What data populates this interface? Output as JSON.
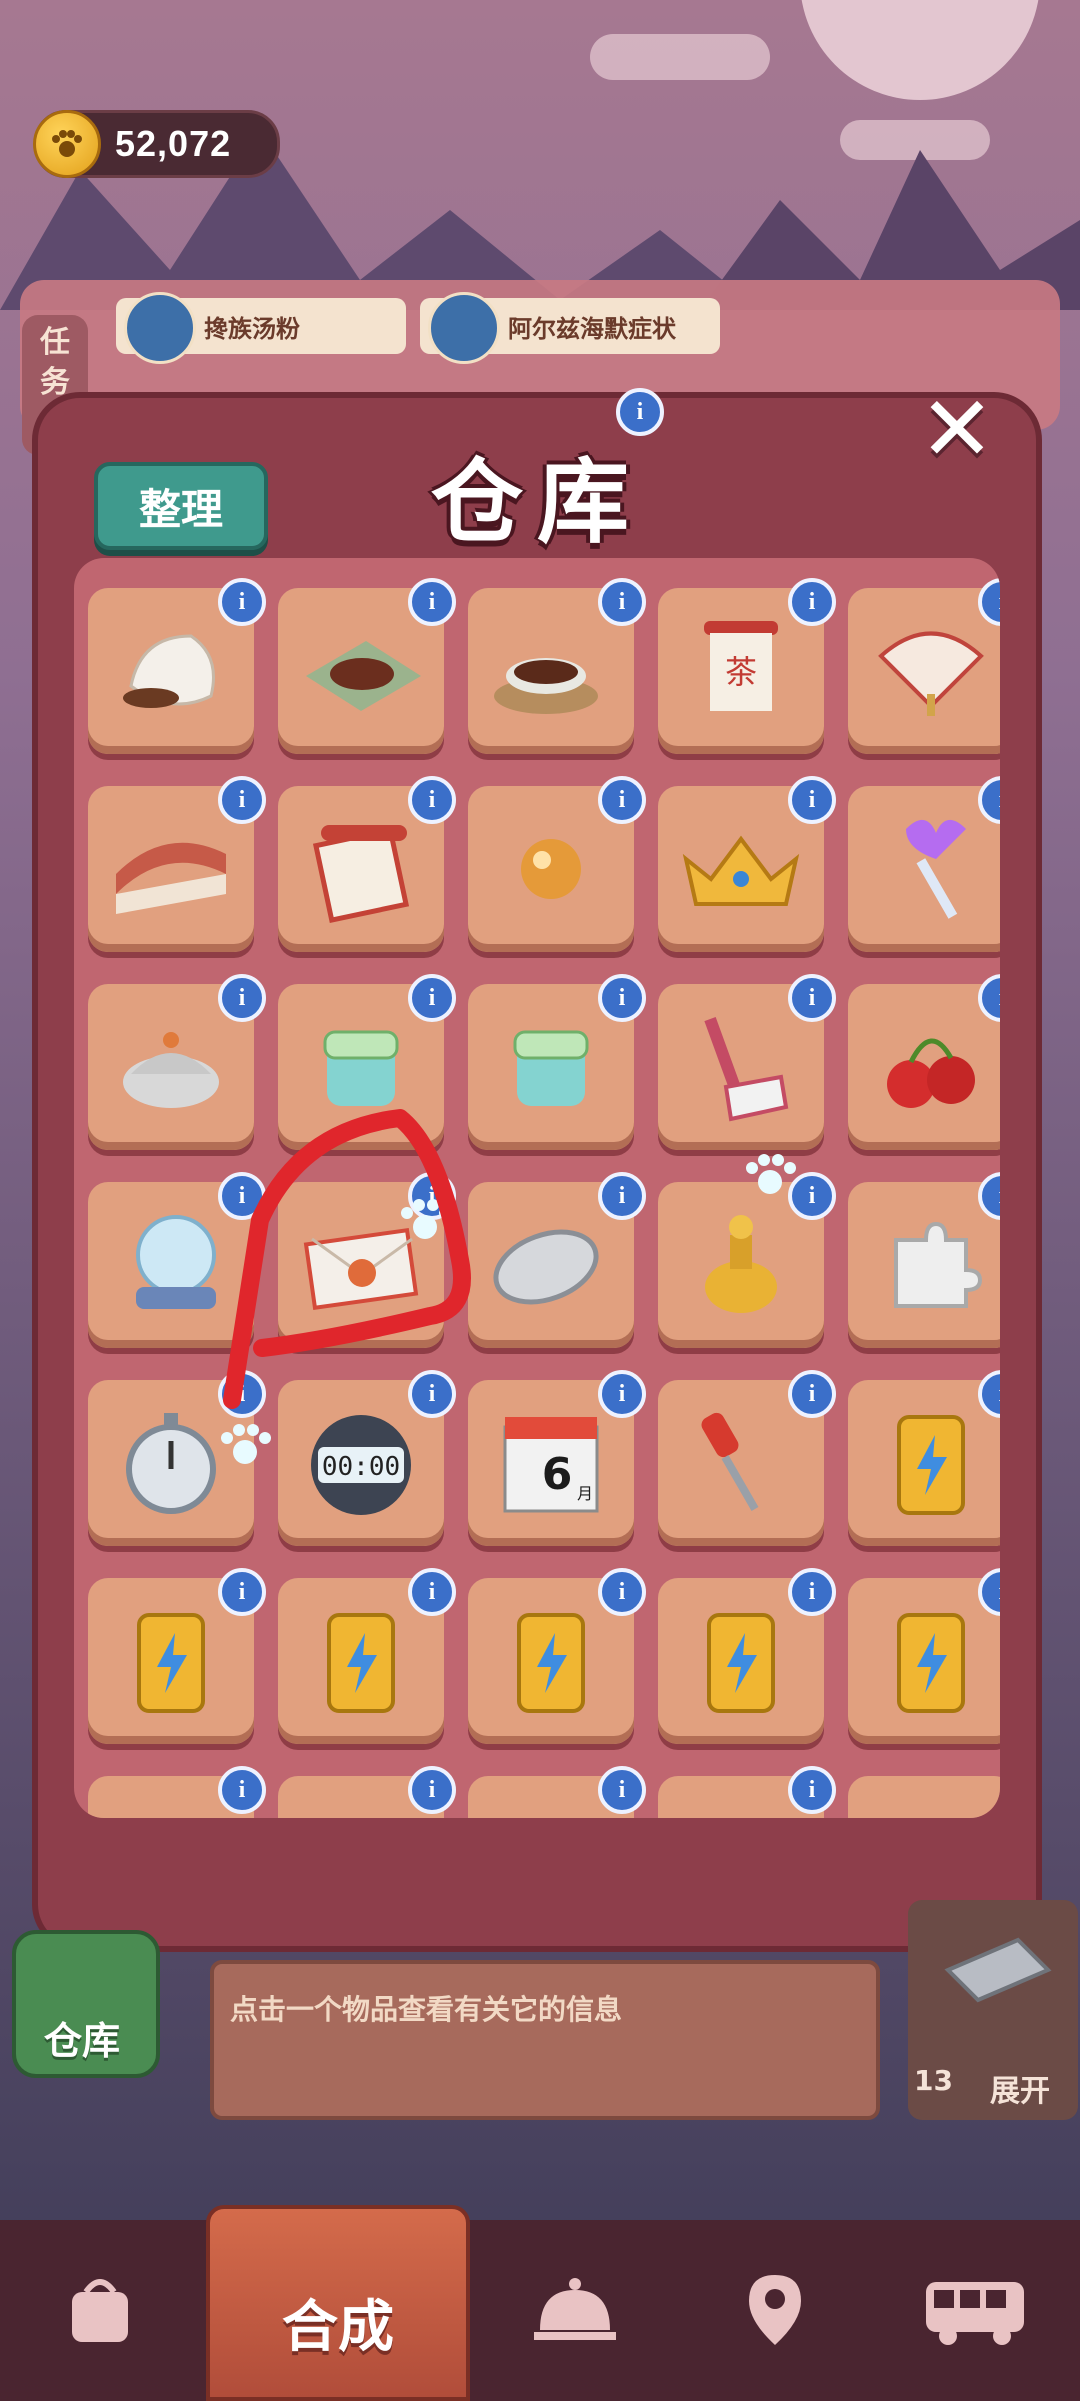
{
  "hud": {
    "coins": "52,072"
  },
  "tasks": {
    "side_label_1": "任",
    "side_label_2": "务",
    "card_1": "搀族汤粉",
    "card_2": "阿尔兹海默症状"
  },
  "modal": {
    "title": "仓库",
    "sort_label": "整理",
    "close_symbol": "✕",
    "info_symbol": "i"
  },
  "items": [
    {
      "name": "sack-of-beans-icon"
    },
    {
      "name": "dried-leaves-mat-icon"
    },
    {
      "name": "bowl-of-tea-leaves-icon"
    },
    {
      "name": "tea-banner-icon"
    },
    {
      "name": "folding-fan-icon"
    },
    {
      "name": "roof-tile-icon"
    },
    {
      "name": "scroll-paper-icon"
    },
    {
      "name": "golden-pearl-icon"
    },
    {
      "name": "golden-crown-icon"
    },
    {
      "name": "magic-wand-icon"
    },
    {
      "name": "clay-pot-icon"
    },
    {
      "name": "green-jar-icon"
    },
    {
      "name": "green-jar-icon"
    },
    {
      "name": "shovel-icon"
    },
    {
      "name": "cherries-icon"
    },
    {
      "name": "crystal-ball-icon"
    },
    {
      "name": "sealed-letter-icon"
    },
    {
      "name": "silver-tray-icon"
    },
    {
      "name": "golden-bottle-icon"
    },
    {
      "name": "puzzle-piece-icon"
    },
    {
      "name": "stopwatch-icon"
    },
    {
      "name": "digital-timer-icon"
    },
    {
      "name": "calendar-icon"
    },
    {
      "name": "screwdriver-icon"
    },
    {
      "name": "energy-battery-icon"
    },
    {
      "name": "energy-battery-icon"
    },
    {
      "name": "energy-battery-icon"
    },
    {
      "name": "energy-battery-icon"
    },
    {
      "name": "energy-battery-icon"
    },
    {
      "name": "energy-battery-icon"
    }
  ],
  "calendar_text": "6",
  "calendar_month": "月",
  "timer_text": "00:00",
  "tea_text": "茶",
  "bottom": {
    "info_hint": "点击一个物品查看有关它的信息",
    "warehouse_label": "仓库",
    "count": "13",
    "expand_label": "展开",
    "merge_label": "合成"
  },
  "colors": {
    "accent": "#8e3e4b",
    "cell": "#e1a07f",
    "info_badge": "#3b6fc9",
    "sort_button": "#3f9a8d",
    "annotation": "#e0262c"
  }
}
